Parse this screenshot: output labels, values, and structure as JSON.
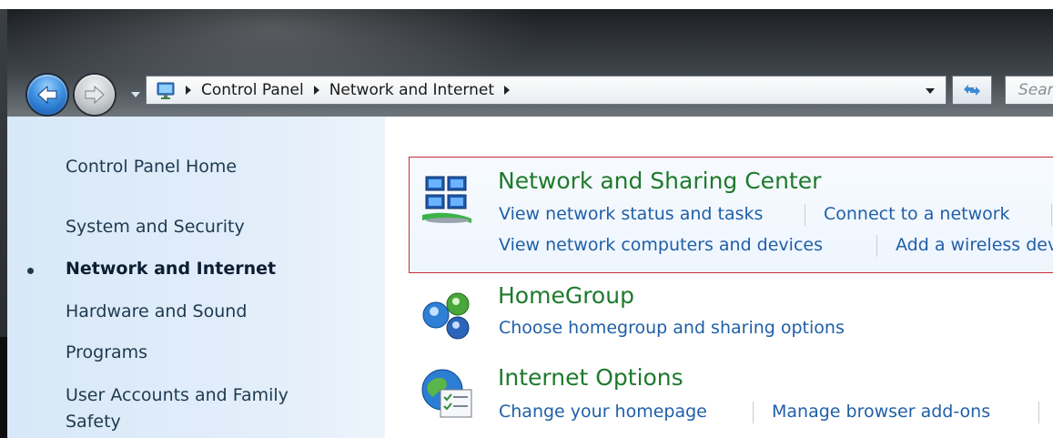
{
  "navigation": {
    "back_icon": "back-arrow-icon",
    "forward_icon": "forward-arrow-icon",
    "history_icon": "chevron-down-icon"
  },
  "address_bar": {
    "location_icon": "control-panel-icon",
    "crumbs": [
      "Control Panel",
      "Network and Internet"
    ],
    "refresh_icon": "refresh-icon",
    "search_placeholder": "Search Control Panel"
  },
  "sidebar": {
    "items": [
      {
        "label": "Control Panel Home",
        "active": false
      },
      {
        "label": "System and Security",
        "active": false
      },
      {
        "label": "Network and Internet",
        "active": true
      },
      {
        "label": "Hardware and Sound",
        "active": false
      },
      {
        "label": "Programs",
        "active": false
      },
      {
        "label": "User Accounts and Family Safety",
        "line1": "User Accounts and Family",
        "line2": "Safety",
        "active": false
      }
    ]
  },
  "categories": [
    {
      "title": "Network and Sharing Center",
      "icon": "network-center-icon",
      "highlighted": true,
      "links": [
        "View network status and tasks",
        "Connect to a network",
        "View network computers and devices",
        "Add a wireless device"
      ]
    },
    {
      "title": "HomeGroup",
      "icon": "homegroup-icon",
      "highlighted": false,
      "links": [
        "Choose homegroup and sharing options"
      ]
    },
    {
      "title": "Internet Options",
      "icon": "internet-options-icon",
      "highlighted": false,
      "links": [
        "Change your homepage",
        "Manage browser add-ons"
      ]
    }
  ],
  "colors": {
    "category_title": "#1e7a2c",
    "link": "#1f5fa8",
    "highlight_border": "#c22f3a",
    "sidebar_bg": "#dde9f7"
  }
}
